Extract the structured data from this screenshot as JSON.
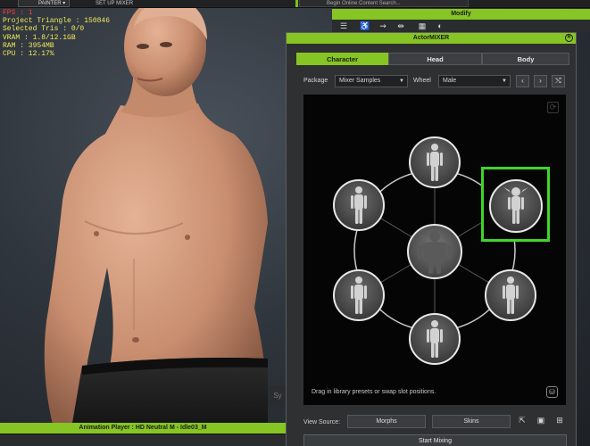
{
  "toolbar": {
    "painter_label": "PAINTER",
    "mixer_label": "SET UP MIXER",
    "search_placeholder": "Begin Online Content Search..."
  },
  "stats": {
    "fps": "FPS : 1",
    "triangles": "Project Triangle : 150846",
    "selected": "Selected Tris : 0/0",
    "vram": "VRAM : 1.8/12.1GB",
    "ram": "RAM : 3954MB",
    "cpu": "CPU : 12.17%"
  },
  "modify": {
    "title": "Modify"
  },
  "mixer": {
    "title": "ActorMIXER",
    "tabs": [
      "Character",
      "Head",
      "Body"
    ],
    "active_tab": "Character",
    "package_label": "Package",
    "package_value": "Mixer Samples",
    "wheel_label": "Wheel",
    "wheel_value": "Male",
    "help_text": "Drag in library presets or swap slot positions.",
    "view_source_label": "View Source:",
    "morphs_button": "Morphs",
    "skins_button": "Skins",
    "start_button": "Start Mixing"
  },
  "animation": {
    "title": "Animation Player : HD Neutral M - Idle03_M"
  },
  "viewport": {
    "ghost_button": "Sy"
  },
  "colors": {
    "accent": "#86c523",
    "highlight": "#3ed62a"
  }
}
